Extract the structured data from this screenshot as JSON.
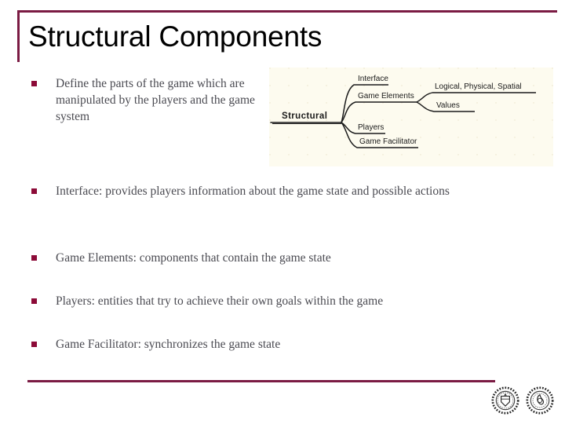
{
  "slide": {
    "title": "Structural Components",
    "accent_color": "#7B1B43",
    "bullet_color": "#8C0B38",
    "text_color": "#4B4B52"
  },
  "bullets": [
    {
      "text": "Define the parts of the game which are manipulated by the players and the game system"
    },
    {
      "text": "Interface: provides players information about the game state and possible actions"
    },
    {
      "text": "Game Elements: components that contain the game state"
    },
    {
      "text": "Players: entities that try to achieve their own goals within the game"
    },
    {
      "text": "Game Facilitator: synchronizes the game state"
    }
  ],
  "diagram": {
    "type": "mindmap",
    "background_color": "#FDFBEF",
    "root": "Structural",
    "branches": [
      {
        "label": "Interface",
        "children": []
      },
      {
        "label": "Game Elements",
        "children": [
          "Logical, Physical, Spatial",
          "Values"
        ]
      },
      {
        "label": "Players",
        "children": []
      },
      {
        "label": "Game Facilitator",
        "children": []
      }
    ],
    "nodes": {
      "root": "Structural",
      "interface": "Interface",
      "game_elements": "Game Elements",
      "players": "Players",
      "game_facilitator": "Game Facilitator",
      "logical_physical_spatial": "Logical, Physical, Spatial",
      "values": "Values"
    }
  },
  "footer": {
    "seal_left": "university-seal-icon",
    "seal_right": "university-seal-icon"
  }
}
